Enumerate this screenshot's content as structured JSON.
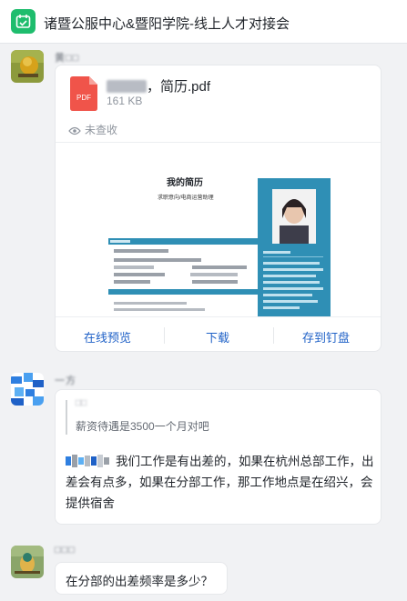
{
  "header": {
    "title": "诸暨公服中心&暨阳学院-线上人才对接会",
    "icon": "group-chat-icon",
    "accent": "#1ebd6d"
  },
  "messages": [
    {
      "type": "file",
      "sender": "黄□□",
      "file": {
        "name": "，简历.pdf",
        "size": "161 KB",
        "status": "未查收",
        "preview": {
          "title": "我的简历",
          "subtitle": "求职意向/电商运营助理"
        },
        "actions": [
          "在线预览",
          "下载",
          "存到钉盘"
        ]
      }
    },
    {
      "type": "reply",
      "sender": "一方",
      "quote": {
        "sender": "□□",
        "text": "薪资待遇是3500一个月对吧"
      },
      "text": "我们工作是有出差的，如果在杭州总部工作，出差会有点多，如果在分部工作，那工作地点是在绍兴，会提供宿舍"
    },
    {
      "type": "text",
      "sender": "□□□",
      "text": "在分部的出差频率是多少？"
    }
  ],
  "colors": {
    "link": "#1f61c7",
    "pdf": "#f0544a",
    "resume_accent": "#2f8fb5"
  }
}
